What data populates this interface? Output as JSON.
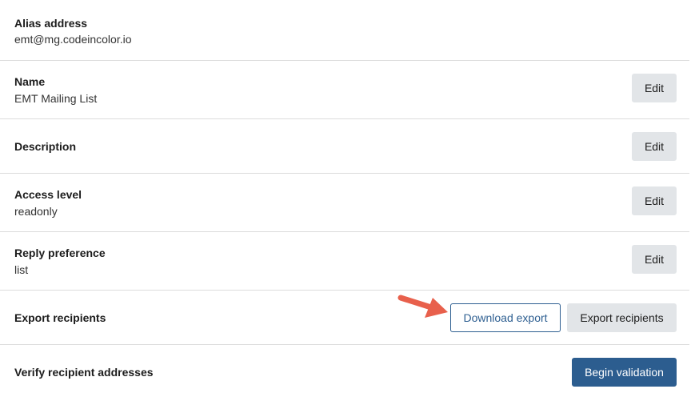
{
  "settings": {
    "alias": {
      "label": "Alias address",
      "value": "emt@mg.codeincolor.io"
    },
    "name": {
      "label": "Name",
      "value": "EMT Mailing List",
      "edit_label": "Edit"
    },
    "description": {
      "label": "Description",
      "edit_label": "Edit"
    },
    "access_level": {
      "label": "Access level",
      "value": "readonly",
      "edit_label": "Edit"
    },
    "reply_preference": {
      "label": "Reply preference",
      "value": "list",
      "edit_label": "Edit"
    },
    "export": {
      "label": "Export recipients",
      "download_label": "Download export",
      "export_label": "Export recipients"
    },
    "verify": {
      "label": "Verify recipient addresses",
      "begin_label": "Begin validation"
    }
  },
  "annotation": {
    "arrow_color": "#e8604c",
    "arrow_icon": "arrow-right-icon"
  },
  "colors": {
    "primary": "#2c5d8f",
    "secondary_button": "#e2e5e8",
    "divider": "#dcdcdc"
  }
}
